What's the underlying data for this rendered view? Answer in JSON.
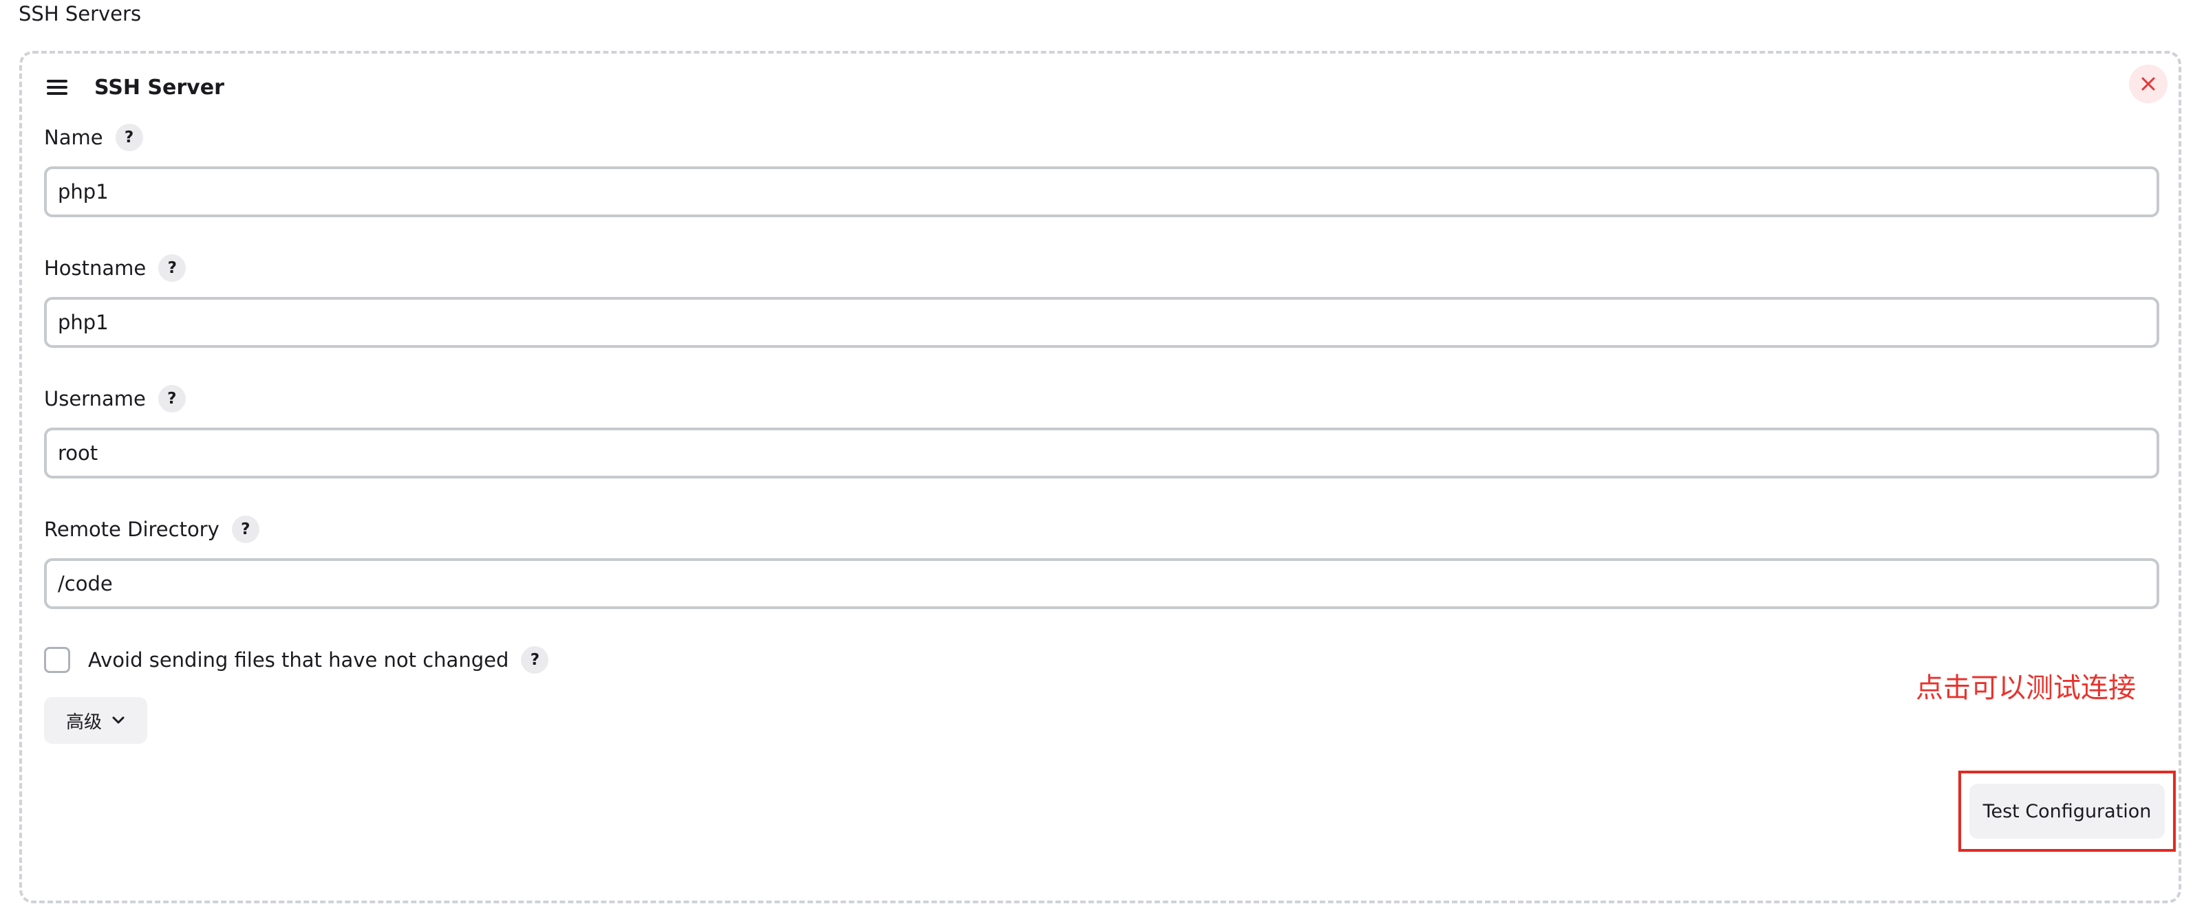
{
  "section": {
    "title": "SSH Servers"
  },
  "server": {
    "title": "SSH Server",
    "drag_icon": "hamburger-icon",
    "delete_icon": "close-icon",
    "fields": [
      {
        "label": "Name",
        "value": "php1"
      },
      {
        "label": "Hostname",
        "value": "php1"
      },
      {
        "label": "Username",
        "value": "root"
      },
      {
        "label": "Remote Directory",
        "value": "/code"
      }
    ],
    "help_glyph": "?",
    "avoid_sending": {
      "label": "Avoid sending files that have not changed",
      "checked": false
    },
    "advanced_label": "高级",
    "test_button_label": "Test Configuration"
  },
  "annotation": {
    "text": "点击可以测试连接",
    "color": "#e8332d"
  },
  "colors": {
    "input_border": "#c6cacd",
    "delete_bg": "#fde8ea",
    "delete_icon": "#e03b3b",
    "button_bg": "#f1f1f3"
  }
}
